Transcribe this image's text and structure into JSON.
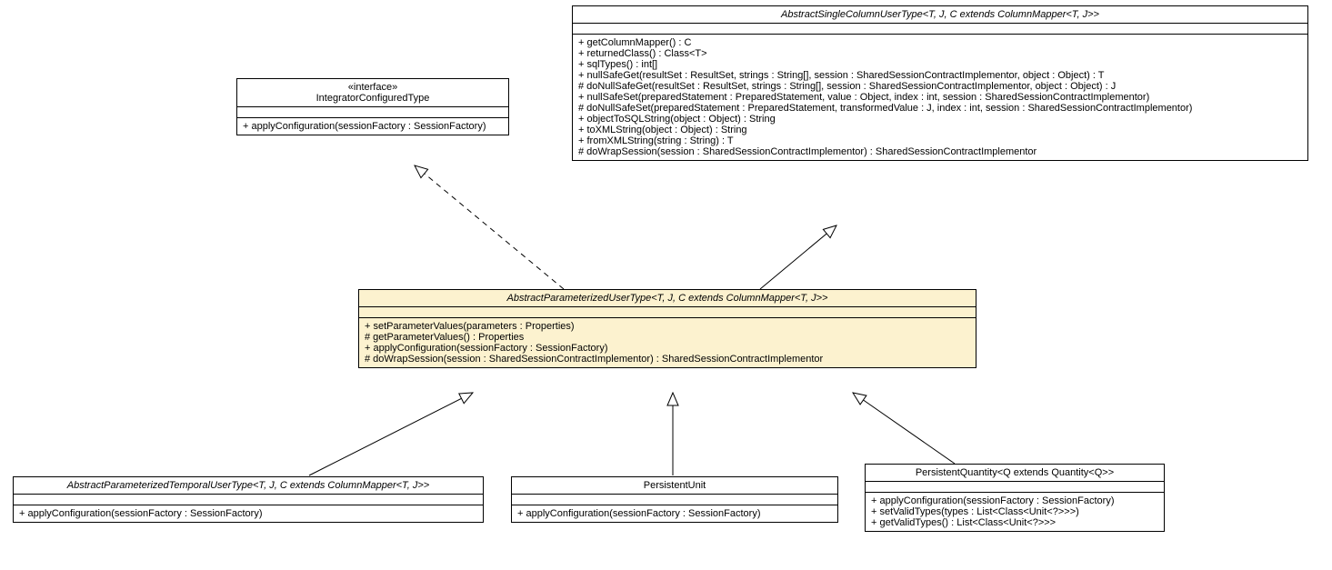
{
  "interface_box": {
    "stereotype": "«interface»",
    "name": "IntegratorConfiguredType",
    "methods": [
      "+ applyConfiguration(sessionFactory : SessionFactory)"
    ]
  },
  "abstract_single_column": {
    "name": "AbstractSingleColumnUserType<T, J, C extends ColumnMapper<T, J>>",
    "methods": [
      "+ getColumnMapper() : C",
      "+ returnedClass() : Class<T>",
      "+ sqlTypes() : int[]",
      "+ nullSafeGet(resultSet : ResultSet, strings : String[], session : SharedSessionContractImplementor, object : Object) : T",
      "# doNullSafeGet(resultSet : ResultSet, strings : String[], session : SharedSessionContractImplementor, object : Object) : J",
      "+ nullSafeSet(preparedStatement : PreparedStatement, value : Object, index : int, session : SharedSessionContractImplementor)",
      "# doNullSafeSet(preparedStatement : PreparedStatement, transformedValue : J, index : int, session : SharedSessionContractImplementor)",
      "+ objectToSQLString(object : Object) : String",
      "+ toXMLString(object : Object) : String",
      "+ fromXMLString(string : String) : T",
      "# doWrapSession(session : SharedSessionContractImplementor) : SharedSessionContractImplementor"
    ]
  },
  "abstract_param": {
    "name": "AbstractParameterizedUserType<T, J, C extends ColumnMapper<T, J>>",
    "methods": [
      "+ setParameterValues(parameters : Properties)",
      "# getParameterValues() : Properties",
      "+ applyConfiguration(sessionFactory : SessionFactory)",
      "# doWrapSession(session : SharedSessionContractImplementor) : SharedSessionContractImplementor"
    ]
  },
  "temporal_box": {
    "name": "AbstractParameterizedTemporalUserType<T, J, C extends ColumnMapper<T, J>>",
    "methods": [
      "+ applyConfiguration(sessionFactory : SessionFactory)"
    ]
  },
  "persistent_unit": {
    "name": "PersistentUnit",
    "methods": [
      "+ applyConfiguration(sessionFactory : SessionFactory)"
    ]
  },
  "persistent_quantity": {
    "name": "PersistentQuantity<Q extends Quantity<Q>>",
    "methods": [
      "+ applyConfiguration(sessionFactory : SessionFactory)",
      "+ setValidTypes(types : List<Class<Unit<?>>>)",
      "+ getValidTypes() : List<Class<Unit<?>>>"
    ]
  }
}
